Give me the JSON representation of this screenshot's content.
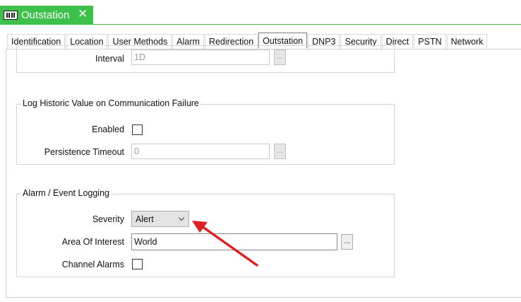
{
  "document_tab": {
    "title": "Outstation",
    "close_glyph": "✕",
    "icon": "outstation-icon"
  },
  "tabs": [
    {
      "label": "Identification",
      "active": false
    },
    {
      "label": "Location",
      "active": false
    },
    {
      "label": "User Methods",
      "active": false
    },
    {
      "label": "Alarm",
      "active": false
    },
    {
      "label": "Redirection",
      "active": false
    },
    {
      "label": "Outstation",
      "active": true
    },
    {
      "label": "DNP3",
      "active": false
    },
    {
      "label": "Security",
      "active": false
    },
    {
      "label": "Direct",
      "active": false
    },
    {
      "label": "PSTN",
      "active": false
    },
    {
      "label": "Network",
      "active": false
    }
  ],
  "interval_section": {
    "interval_label": "Interval",
    "interval_value": "1D",
    "browse_label": "..."
  },
  "historic_group": {
    "title": "Log Historic Value on Communication Failure",
    "enabled_label": "Enabled",
    "enabled_checked": false,
    "persistence_label": "Persistence Timeout",
    "persistence_value": "0",
    "browse_label": "..."
  },
  "alarm_group": {
    "title": "Alarm / Event Logging",
    "severity_label": "Severity",
    "severity_value": "Alert",
    "area_label": "Area Of Interest",
    "area_value": "World",
    "browse_label": "...",
    "channel_alarms_label": "Channel Alarms",
    "channel_alarms_checked": false
  },
  "colors": {
    "header_green": "#3cc24a",
    "annotation_arrow": "#e02020"
  }
}
